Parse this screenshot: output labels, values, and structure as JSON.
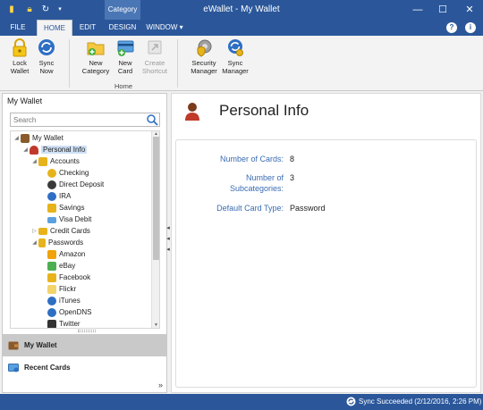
{
  "window": {
    "title": "eWallet - My Wallet",
    "context_tab": "Category",
    "controls": {
      "minimize": "—",
      "maximize": "☐",
      "close": "✕"
    }
  },
  "tabs": [
    {
      "label": "FILE"
    },
    {
      "label": "HOME"
    },
    {
      "label": "EDIT"
    },
    {
      "label": "DESIGN"
    },
    {
      "label": "WINDOW ▾"
    }
  ],
  "help": {
    "question": "?",
    "info": "i"
  },
  "ribbon": {
    "group_label": "Home",
    "buttons": {
      "lock_wallet": {
        "line1": "Lock",
        "line2": "Wallet"
      },
      "sync_now": {
        "line1": "Sync",
        "line2": "Now"
      },
      "new_category": {
        "line1": "New",
        "line2": "Category"
      },
      "new_card": {
        "line1": "New",
        "line2": "Card"
      },
      "create_shortcut": {
        "line1": "Create",
        "line2": "Shortcut"
      },
      "security_manager": {
        "line1": "Security",
        "line2": "Manager"
      },
      "sync_manager": {
        "line1": "Sync",
        "line2": "Manager"
      }
    }
  },
  "left_panel": {
    "header": "My Wallet",
    "search_placeholder": "Search",
    "tree": [
      {
        "label": "My Wallet"
      },
      {
        "label": "Personal Info"
      },
      {
        "label": "Accounts"
      },
      {
        "label": "Checking"
      },
      {
        "label": "Direct Deposit"
      },
      {
        "label": "IRA"
      },
      {
        "label": "Savings"
      },
      {
        "label": "Visa Debit"
      },
      {
        "label": "Credit Cards"
      },
      {
        "label": "Passwords"
      },
      {
        "label": "Amazon"
      },
      {
        "label": "eBay"
      },
      {
        "label": "Facebook"
      },
      {
        "label": "Flickr"
      },
      {
        "label": "iTunes"
      },
      {
        "label": "OpenDNS"
      },
      {
        "label": "Twitter"
      }
    ],
    "nav": {
      "my_wallet": "My Wallet",
      "recent_cards": "Recent Cards",
      "more": "»"
    }
  },
  "main": {
    "title": "Personal Info",
    "fields": {
      "cards_label": "Number of Cards:",
      "cards_value": "8",
      "subcat_label_line1": "Number of",
      "subcat_label_line2": "Subcategories:",
      "subcat_value": "3",
      "default_type_label": "Default Card Type:",
      "default_type_value": "Password"
    }
  },
  "status": {
    "text": "Sync Succeeded (2/12/2016, 2:26 PM)"
  },
  "colors": {
    "accent": "#2b579a",
    "context_tab": "#4a76b5",
    "label_blue": "#3a6cb3"
  }
}
